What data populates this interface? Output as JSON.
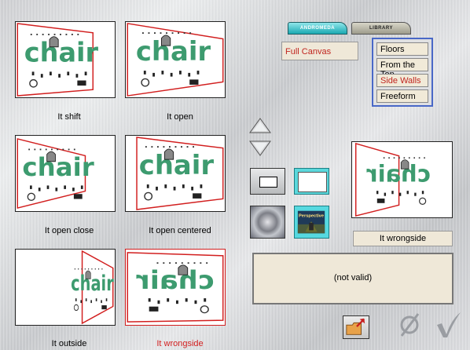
{
  "thumbnails": [
    {
      "label": "It shift",
      "selected": false
    },
    {
      "label": "It open",
      "selected": false
    },
    {
      "label": "It open close",
      "selected": false
    },
    {
      "label": "It open centered",
      "selected": false
    },
    {
      "label": "It outside",
      "selected": false
    },
    {
      "label": "It wrongside",
      "selected": true
    }
  ],
  "thumbnail_text": "chair",
  "tabs": {
    "andromeda": "ANDROMEDA",
    "library": "LIBRARY"
  },
  "canvas_mode": "Full Canvas",
  "menu": {
    "items": [
      {
        "label": "Floors",
        "highlight": false
      },
      {
        "label": "From the Top",
        "highlight": false
      },
      {
        "label": "Side Walls",
        "highlight": true
      },
      {
        "label": "Freeform",
        "highlight": false
      }
    ]
  },
  "perspective_button_text": "Perspective",
  "preview_caption": "It wrongside",
  "info_panel_text": "(not valid)",
  "colors": {
    "accent_red": "#d21f1f",
    "menu_border": "#4968c7",
    "tab_teal": "#1aa9b2",
    "chair_green": "#3d9b6f"
  },
  "icons": [
    "up-arrow-icon",
    "down-arrow-icon",
    "rectangle-icon",
    "canvas-icon",
    "folder-icon",
    "empty-set-icon",
    "checkmark-icon"
  ]
}
